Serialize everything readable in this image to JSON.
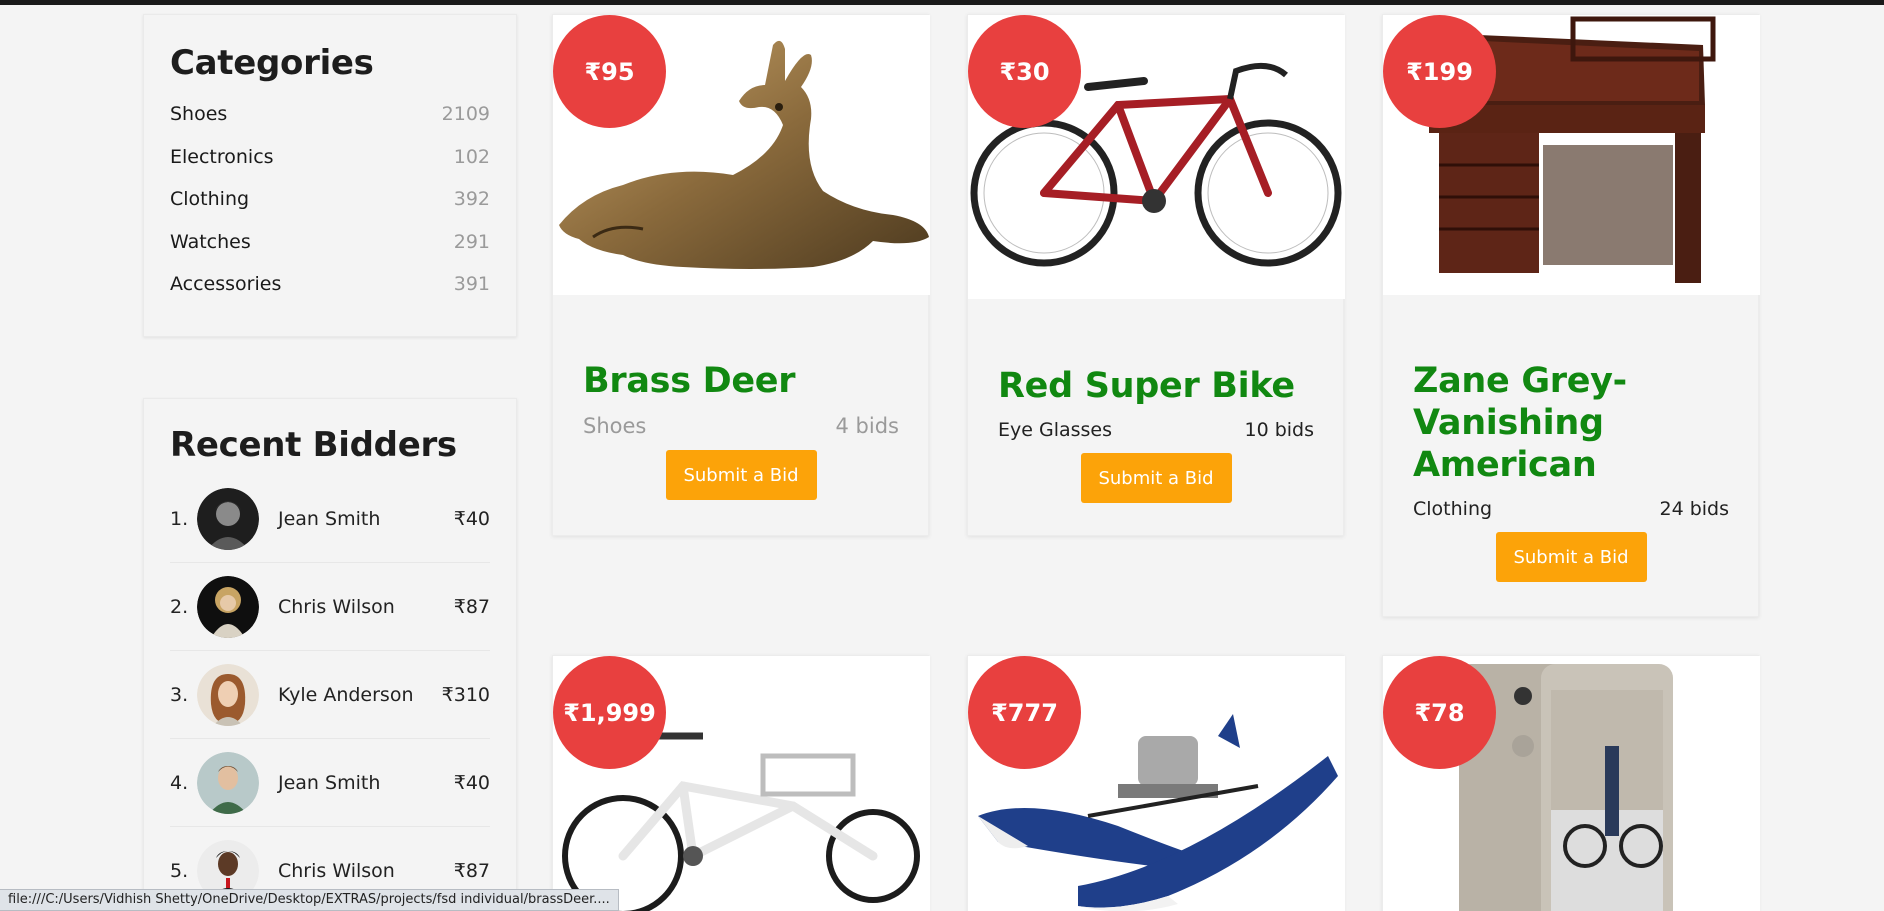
{
  "categories": {
    "title": "Categories",
    "items": [
      {
        "name": "Shoes",
        "count": "2109"
      },
      {
        "name": "Electronics",
        "count": "102"
      },
      {
        "name": "Clothing",
        "count": "392"
      },
      {
        "name": "Watches",
        "count": "291"
      },
      {
        "name": "Accessories",
        "count": "391"
      }
    ]
  },
  "bidders": {
    "title": "Recent Bidders",
    "items": [
      {
        "rank": "1.",
        "name": "Jean Smith",
        "amount": "₹40"
      },
      {
        "rank": "2.",
        "name": "Chris Wilson",
        "amount": "₹87"
      },
      {
        "rank": "3.",
        "name": "Kyle Anderson",
        "amount": "₹310"
      },
      {
        "rank": "4.",
        "name": "Jean Smith",
        "amount": "₹40"
      },
      {
        "rank": "5.",
        "name": "Chris Wilson",
        "amount": "₹87"
      }
    ]
  },
  "products": [
    {
      "price": "₹95",
      "title": "Brass Deer",
      "category": "Shoes",
      "bids": "4 bids",
      "button": "Submit a Bid",
      "image_icon": "brass-deer-image"
    },
    {
      "price": "₹30",
      "title": "Red Super Bike",
      "category": "Eye Glasses",
      "bids": "10 bids",
      "button": "Submit a Bid",
      "image_icon": "red-bike-image"
    },
    {
      "price": "₹199",
      "title": "Zane Grey-Vanishing American",
      "category": "Clothing",
      "bids": "24 bids",
      "button": "Submit a Bid",
      "image_icon": "wooden-desk-image"
    },
    {
      "price": "₹1,999",
      "image_icon": "white-cargo-bike-image"
    },
    {
      "price": "₹777",
      "image_icon": "pontoon-boat-image"
    },
    {
      "price": "₹78",
      "image_icon": "smartphone-image"
    }
  ],
  "status_bar": {
    "url": "file:///C:/Users/Vidhish Shetty/OneDrive/Desktop/EXTRAS/projects/fsd individual/brassDeer...."
  },
  "colors": {
    "price_badge": "#e8403f",
    "title_green": "#118811",
    "button_orange": "#fca309"
  }
}
